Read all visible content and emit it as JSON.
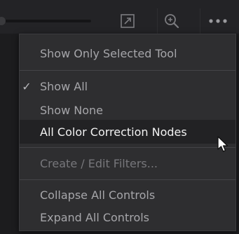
{
  "toolbar": {
    "icons": [
      "resize-icon",
      "zoom-icon",
      "more-options-icon"
    ]
  },
  "menu": {
    "items": [
      {
        "label": "Show Only Selected Tool",
        "checked": false,
        "state": "normal"
      },
      {
        "label": "Show All",
        "checked": true,
        "state": "normal"
      },
      {
        "label": "Show None",
        "checked": false,
        "state": "normal"
      },
      {
        "label": "All Color Correction Nodes",
        "checked": false,
        "state": "hover"
      },
      {
        "label": "Create / Edit Filters...",
        "checked": false,
        "state": "disabled"
      },
      {
        "label": "Collapse All Controls",
        "checked": false,
        "state": "normal"
      },
      {
        "label": "Expand All Controls",
        "checked": false,
        "state": "normal"
      }
    ],
    "check_glyph": "✓"
  },
  "colors": {
    "menu_bg": "#2e2e30",
    "hover_bg": "#222224",
    "hover_text": "#f2f2f2",
    "text": "#a6a6aa"
  }
}
